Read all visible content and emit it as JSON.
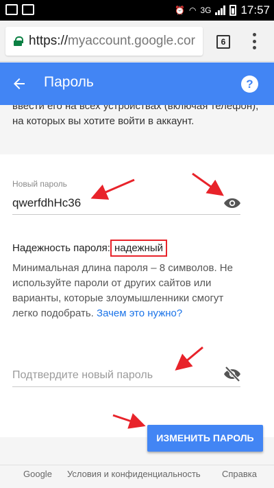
{
  "status_bar": {
    "network": "3G",
    "time": "17:57"
  },
  "browser": {
    "url_scheme": "https://",
    "url_host": "myaccount.google.cor",
    "tab_count": "6"
  },
  "app_bar": {
    "title": "Пароль",
    "help_glyph": "?"
  },
  "content": {
    "intro_text": "ввести его на всех устройствах (включая телефон), на которых вы хотите войти в аккаунт.",
    "new_password": {
      "label": "Новый пароль",
      "value": "qwerfdhHc36"
    },
    "strength": {
      "label": "Надежность пароля:",
      "value": "надежный"
    },
    "help_text": "Минимальная длина пароля – 8 символов. Не используйте пароли от других сайтов или варианты, которые злоумышленники смогут легко подобрать.",
    "why_link": "Зачем это нужно?",
    "confirm_password": {
      "placeholder": "Подтвердите новый пароль"
    },
    "submit_label": "ИЗМЕНИТЬ ПАРОЛЬ"
  },
  "footer": {
    "links": [
      "Google",
      "Условия и конфиденциальность",
      "Справка"
    ]
  },
  "colors": {
    "accent": "#4285f4",
    "annotation": "#e8232a",
    "secure_lock": "#0b8043"
  }
}
